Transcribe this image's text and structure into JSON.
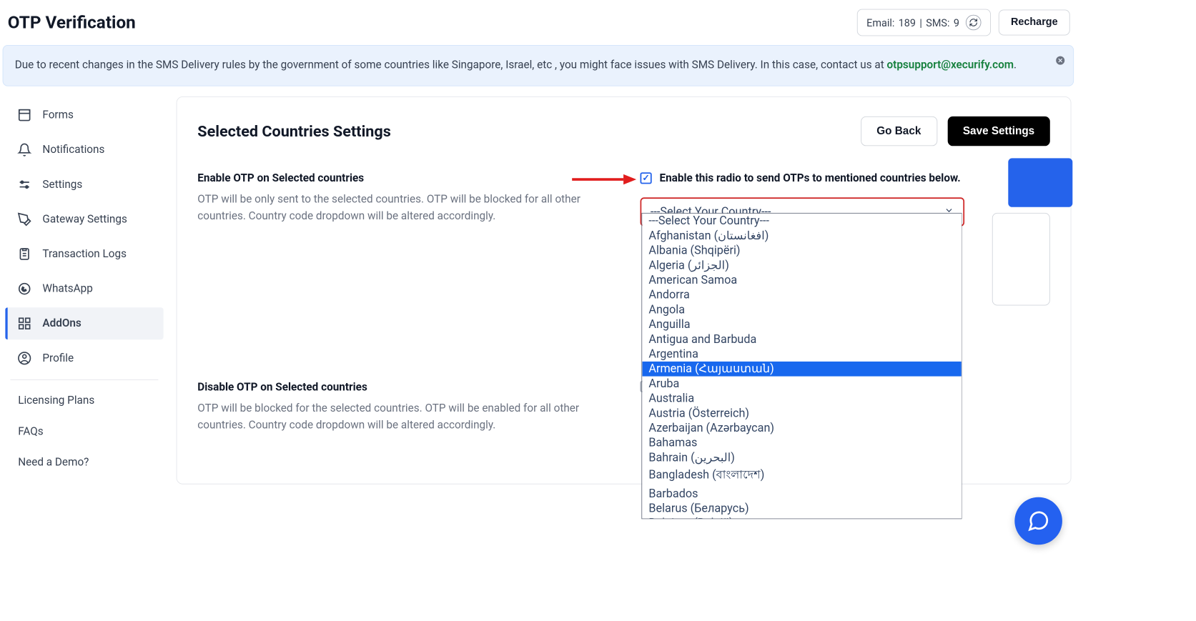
{
  "header": {
    "title": "OTP Verification",
    "email_label": "Email:",
    "email_count": "189",
    "sms_label": "SMS:",
    "sms_count": "9",
    "recharge_label": "Recharge"
  },
  "alert": {
    "text_before_link": "Due to recent changes in the SMS Delivery rules by the government of some countries like Singapore, Israel, etc , you might face issues with SMS Delivery. In this case, contact us at ",
    "link_text": "otpsupport@xecurify.com",
    "after_link": "."
  },
  "sidebar": {
    "items": [
      {
        "label": "Forms",
        "icon": "form"
      },
      {
        "label": "Notifications",
        "icon": "bell"
      },
      {
        "label": "Settings",
        "icon": "sliders"
      },
      {
        "label": "Gateway Settings",
        "icon": "pen"
      },
      {
        "label": "Transaction Logs",
        "icon": "clipboard"
      },
      {
        "label": "WhatsApp",
        "icon": "whatsapp"
      },
      {
        "label": "AddOns",
        "icon": "grid"
      },
      {
        "label": "Profile",
        "icon": "user"
      }
    ],
    "links": [
      {
        "label": "Licensing Plans"
      },
      {
        "label": "FAQs"
      },
      {
        "label": "Need a Demo?"
      }
    ]
  },
  "main": {
    "title": "Selected Countries Settings",
    "go_back": "Go Back",
    "save": "Save Settings",
    "enable_section": {
      "label": "Enable OTP on Selected countries",
      "desc": "OTP will be only sent to the selected countries. OTP will be blocked for all other countries. Country code dropdown will be altered accordingly."
    },
    "disable_section": {
      "label": "Disable OTP on Selected countries",
      "desc": "OTP will be blocked for the selected countries. OTP will be enabled for all other countries. Country code dropdown will be altered accordingly."
    },
    "enable_check_label": "Enable this radio to send OTPs to mentioned countries below.",
    "select_placeholder": "---Select Your Country---",
    "dropdown_options": [
      "---Select Your Country---",
      "Afghanistan (افغانستان)",
      "Albania (Shqipëri)",
      "Algeria (الجزائر)",
      "American Samoa",
      "Andorra",
      "Angola",
      "Anguilla",
      "Antigua and Barbuda",
      "Argentina",
      "Armenia (Հայաստան)",
      "Aruba",
      "Australia",
      "Austria (Österreich)",
      "Azerbaijan (Azərbaycan)",
      "Bahamas",
      "Bahrain (البحرين)",
      "Bangladesh (বাংলাদেশ)",
      "Barbados",
      "Belarus (Беларусь)",
      "Belgium (België)"
    ],
    "highlighted_option": "Armenia (Հայաստան)"
  }
}
